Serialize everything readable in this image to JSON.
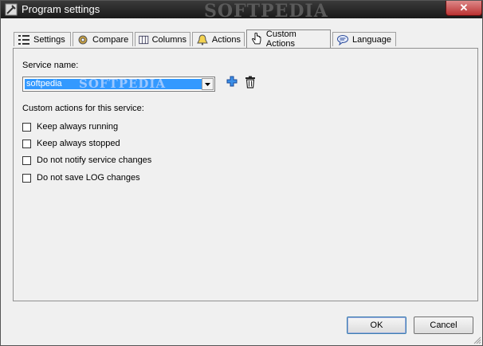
{
  "window": {
    "title": "Program settings",
    "watermark": "SOFTPEDIA",
    "close_symbol": "✕"
  },
  "tabs": [
    {
      "label": "Settings",
      "icon": "settings-list-icon"
    },
    {
      "label": "Compare",
      "icon": "gear-icon"
    },
    {
      "label": "Columns",
      "icon": "columns-icon"
    },
    {
      "label": "Actions",
      "icon": "bell-icon"
    },
    {
      "label": "Custom Actions",
      "icon": "hand-cursor-icon",
      "active": true
    },
    {
      "label": "Language",
      "icon": "speech-bubble-icon"
    }
  ],
  "service": {
    "label": "Service name:",
    "selected": "softpedia",
    "combo_watermark": "SOFTPEDIA"
  },
  "custom_actions": {
    "label": "Custom actions for this service:",
    "options": [
      {
        "label": "Keep always running",
        "checked": false
      },
      {
        "label": "Keep always stopped",
        "checked": false
      },
      {
        "label": "Do not notify service changes",
        "checked": false
      },
      {
        "label": "Do not save LOG changes",
        "checked": false
      }
    ]
  },
  "buttons": {
    "ok": "OK",
    "cancel": "Cancel"
  },
  "colors": {
    "selection": "#3399ff",
    "add_icon": "#2a6fd8"
  }
}
